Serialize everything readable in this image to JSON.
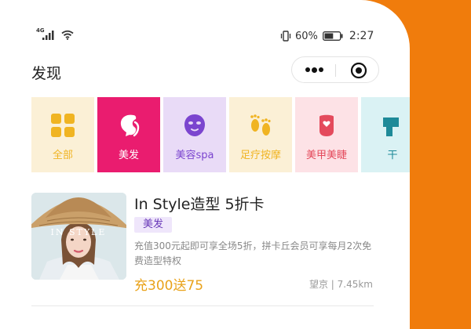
{
  "status_bar": {
    "network_label": "4G",
    "battery_percent": "60%",
    "battery_level": 0.6,
    "time": "2:27"
  },
  "nav": {
    "title": "发现",
    "more_icon": "more-dots-icon",
    "close_icon": "target-circle-icon"
  },
  "categories": [
    {
      "label": "全部",
      "icon": "grid-icon",
      "bg": "#fbf0d6",
      "color": "#f0b422"
    },
    {
      "label": "美发",
      "icon": "hair-icon",
      "bg": "#ea1c6f",
      "color": "#ffffff"
    },
    {
      "label": "美容spa",
      "icon": "face-mask-icon",
      "bg": "#e9dbf7",
      "color": "#7b45cf"
    },
    {
      "label": "足疗按摩",
      "icon": "footprints-icon",
      "bg": "#fbf0d6",
      "color": "#f0b422"
    },
    {
      "label": "美甲美睫",
      "icon": "nail-icon",
      "bg": "#fde2e6",
      "color": "#e44a5c"
    },
    {
      "label": "干",
      "icon": "dryclean-icon",
      "bg": "#daf2f4",
      "color": "#1e8a98"
    }
  ],
  "listing": {
    "title": "In Style造型 5折卡",
    "image_text": "IN STYLE",
    "tag": "美发",
    "description": "充值300元起即可享全场5折，拼卡丘会员可享每月2次免费造型特权",
    "price": "充300送75",
    "location": "望京 | 7.45km"
  }
}
